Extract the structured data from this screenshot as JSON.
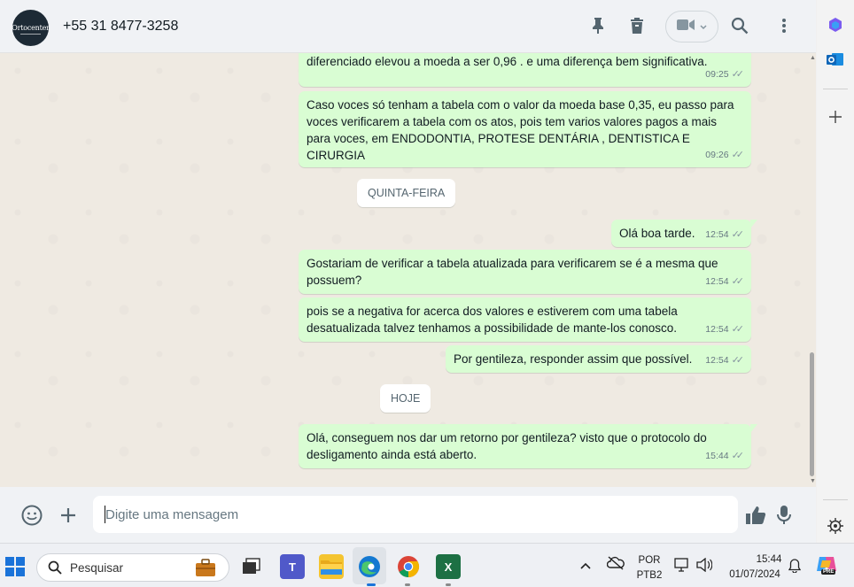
{
  "header": {
    "avatar_text": "Ortocenter",
    "contact_name": "+55 31 8477-3258",
    "icons": [
      "pin-icon",
      "trash-icon",
      "video-call-icon",
      "search-icon",
      "menu-icon"
    ]
  },
  "messages": [
    {
      "text": "diferenciado elevou a moeda a ser 0,96 . e uma diferença bem significativa.",
      "time": "09:25"
    },
    {
      "text": "Caso voces só tenham a tabela com o valor da moeda base 0,35, eu passo para voces verificarem a tabela com os atos, pois tem varios valores pagos a mais para voces, em ENDODONTIA, PROTESE DENTÁRIA , DENTISTICA E CIRURGIA",
      "time": "09:26"
    },
    {
      "day": "QUINTA-FEIRA"
    },
    {
      "text": "Olá boa tarde.",
      "time": "12:54"
    },
    {
      "text": "Gostariam de verificar a tabela atualizada para verificarem se é a mesma que possuem?",
      "time": "12:54"
    },
    {
      "text": "pois se a negativa for acerca dos valores e estiverem com uma tabela desatualizada talvez tenhamos a possibilidade de mante-los conosco.",
      "time": "12:54"
    },
    {
      "text": "Por gentileza, responder assim que possível.",
      "time": "12:54"
    },
    {
      "day": "HOJE"
    },
    {
      "text": "Olá, conseguem nos dar um retorno por gentileza? visto que o protocolo do desligamento ainda está aberto.",
      "time": "15:44"
    }
  ],
  "composer": {
    "placeholder": "Digite uma mensagem"
  },
  "taskbar": {
    "search_label": "Pesquisar",
    "lang_top": "POR",
    "lang_bottom": "PTB2",
    "clock_time": "15:44",
    "clock_date": "01/07/2024",
    "copilot_badge": "PRE"
  },
  "colors": {
    "outgoing_bubble": "#d9fdd3",
    "chat_background": "#efeae2",
    "header_background": "#f0f2f5"
  }
}
